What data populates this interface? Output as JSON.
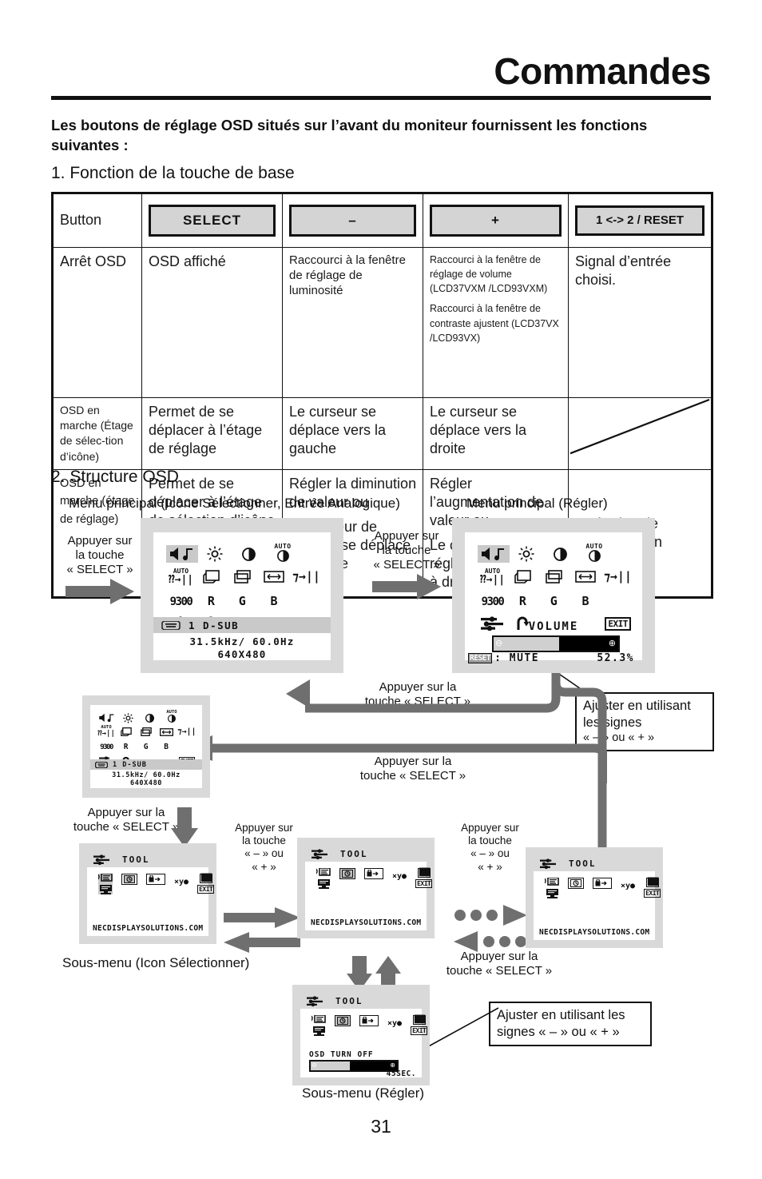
{
  "header": {
    "title": "Commandes",
    "intro": "Les boutons de réglage OSD situés sur l’avant du moniteur fournissent les fonctions suivantes :",
    "section1": "1. Fonction de la touche de base",
    "section2": "2. Structure OSD"
  },
  "table": {
    "headers": {
      "col0": "Button",
      "col1": "SELECT",
      "col2": "–",
      "col3": "+",
      "col4": "1 <-> 2 / RESET"
    },
    "rows": [
      {
        "c0": "Arrêt OSD",
        "c1": "OSD affiché",
        "c2": "Raccourci à la fenêtre de réglage de luminosité",
        "c3a": "Raccourci à la fenêtre de réglage de volume (LCD37VXM /LCD93VXM)",
        "c3b": "Raccourci à la fenêtre de contraste ajustent (LCD37VX /LCD93VX)",
        "c4": "Signal d’entrée choisi."
      },
      {
        "c0": "OSD en marche (Étage de sélec-tion d’icône)",
        "c1": "Permet de se déplacer à l’étage de réglage",
        "c2": "Le curseur se déplace vers la gauche",
        "c3": "Le curseur se déplace vers la droite",
        "c4": ""
      },
      {
        "c0": "OSD en marche (étage de réglage)",
        "c1": "Permet de se déplacer à l’étage de sélection d’icône",
        "c2a": "Régler la diminution de valeur ou",
        "c2b": "Le curseur de réglage se déplace à gauche",
        "c3a": "Régler l’augmentation de valeur  ou",
        "c3b": "Le curseur de réglage se déplace à droite",
        "c4": "Opération de réinitialisation"
      }
    ]
  },
  "diagram": {
    "caption_main_select": "Menu principal (Icône Sélectionner, Entrée Analogique)",
    "caption_main_adjust": "Menu principal (Régler)",
    "caption_sub_select": "Sous-menu (Icon Sélectionner)",
    "caption_sub_adjust": "Sous-menu (Régler)",
    "press_select_1": "Appuyer sur\nla touche\n« SELECT »",
    "press_select_2": "Appuyer sur\nla touche\n« SELECT »",
    "press_select_3": "Appuyer sur la\ntouche « SELECT »",
    "press_select_4": "Appuyer sur la\ntouche « SELECT »",
    "press_select_5": "Appuyer sur la\ntouche « SELECT »",
    "press_select_6": "Appuyer sur la\ntouche « SELECT »",
    "press_plusminus_1": "Appuyer sur\nla touche\n« – » ou\n« + »",
    "press_plusminus_2": "Appuyer sur\nla touche\n« – » ou\n« + »",
    "callout_adjust_1_line1": "Ajuster en utilisant",
    "callout_adjust_1_line2": "les signes",
    "callout_adjust_1_line3": "« – » ou « + »",
    "callout_adjust_2_line1": "Ajuster en utilisant les",
    "callout_adjust_2_line2": "signes « – » ou « + »"
  },
  "osd": {
    "main_icons_row1": [
      "speaker-note-icon",
      "brightness-icon",
      "contrast-icon",
      "auto-contrast-icon"
    ],
    "main_icons_row2": [
      "auto-adjust-icon",
      "h-position-icon",
      "v-position-icon",
      "h-size-icon",
      "fine-icon"
    ],
    "main_icons_row3_labels": [
      "9300",
      "R",
      "G",
      "B"
    ],
    "main_icons_row4": [
      "tool-icon",
      "reset-icon",
      "EXIT"
    ],
    "input_line": "1   D-SUB",
    "freq_line": "31.5kHz/  60.0Hz",
    "res_line": "640X480",
    "volume_label": "VOLUME",
    "volume_reset_tag": "RESET",
    "volume_mute": ": MUTE",
    "volume_value": "52.3%",
    "volume_percent": 52.3,
    "tool_title": "TOOL",
    "tool_footer": "NECDISPLAYSOLUTIONS.COM",
    "tool_icons": [
      "language-icon",
      "osd-timer-icon",
      "osd-lock-icon",
      "resolution-notifier-icon",
      "monitor-info-icon",
      "EXIT"
    ],
    "osd_turn_off_label": "OSD  TURN  OFF",
    "osd_turn_off_value": "45SEC.",
    "osd_turn_off_percent": 45
  },
  "footer": {
    "page_number": "31"
  },
  "colors": {
    "ink": "#111111",
    "panel_bg": "#d9d9d9",
    "panel_screen": "#ffffff",
    "highlight": "#c9c9c9",
    "arrow_gray": "#6f6f6f",
    "button_fill": "#d4d4d4"
  }
}
